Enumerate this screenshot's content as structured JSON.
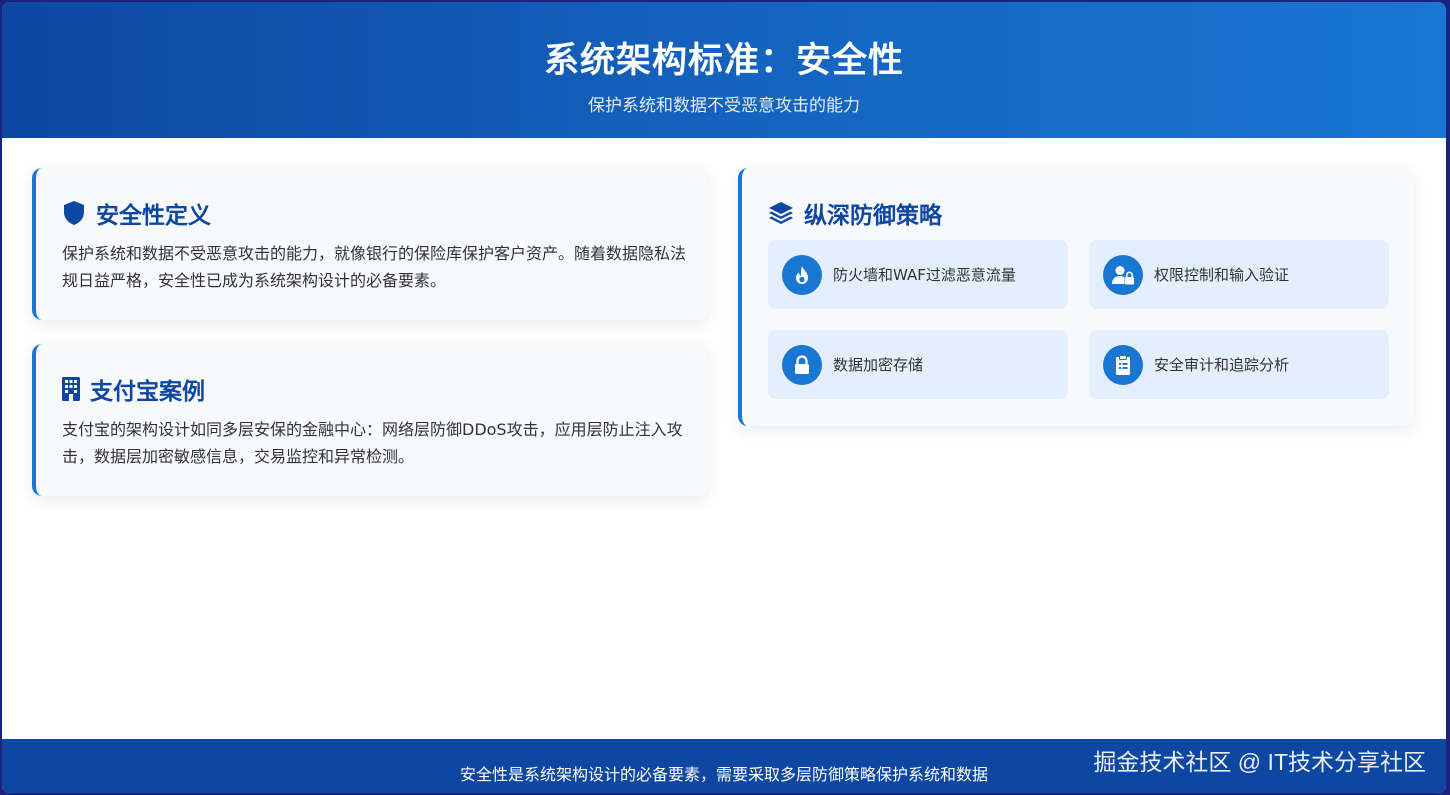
{
  "header": {
    "title": "系统架构标准：安全性",
    "subtitle": "保护系统和数据不受恶意攻击的能力"
  },
  "definition_card": {
    "icon": "shield-icon",
    "title": "安全性定义",
    "body": "保护系统和数据不受恶意攻击的能力，就像银行的保险库保护客户资产。随着数据隐私法规日益严格，安全性已成为系统架构设计的必备要素。"
  },
  "case_card": {
    "icon": "building-icon",
    "title": "支付宝案例",
    "body": "支付宝的架构设计如同多层安保的金融中心：网络层防御DDoS攻击，应用层防止注入攻击，数据层加密敏感信息，交易监控和异常检测。"
  },
  "strategy_card": {
    "icon": "layers-icon",
    "title": "纵深防御策略",
    "items": [
      {
        "icon": "fire-icon",
        "label": "防火墙和WAF过滤恶意流量"
      },
      {
        "icon": "user-lock-icon",
        "label": "权限控制和输入验证"
      },
      {
        "icon": "lock-icon",
        "label": "数据加密存储"
      },
      {
        "icon": "clipboard-icon",
        "label": "安全审计和追踪分析"
      }
    ]
  },
  "footer": {
    "message": "安全性是系统架构设计的必备要素，需要采取多层防御策略保护系统和数据",
    "watermark": "掘金技术社区 @ IT技术分享社区"
  },
  "colors": {
    "primary": "#0d47a1",
    "accent": "#1976d2",
    "card_bg": "#f7f9fc",
    "feature_bg": "#e3effc"
  }
}
